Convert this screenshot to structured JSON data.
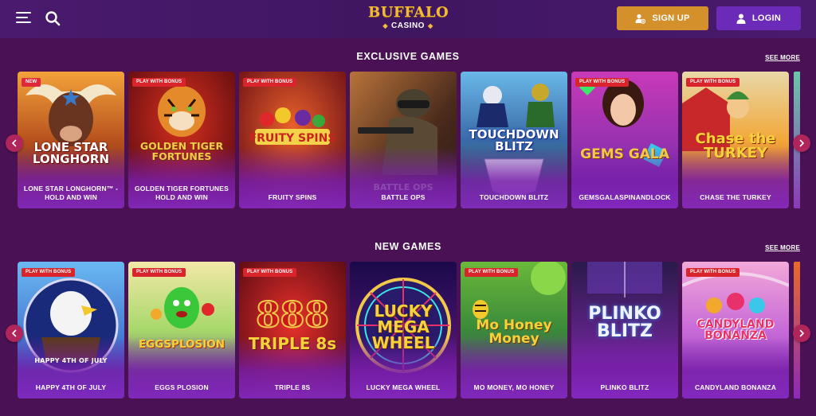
{
  "header": {
    "logo_main": "BUFFALO",
    "logo_sub": "CASINO",
    "signup_label": "SIGN UP",
    "login_label": "LOGIN"
  },
  "sections": [
    {
      "title": "EXCLUSIVE GAMES",
      "see_more": "SEE MORE",
      "games": [
        {
          "name": "LONE STAR LONGHORN™ - HOLD AND WIN",
          "badge": "NEW",
          "art_title": "LONE STAR LONGHORN"
        },
        {
          "name": "GOLDEN TIGER FORTUNES HOLD AND WIN",
          "badge": "PLAY WITH BONUS",
          "art_title": "GOLDEN TIGER FORTUNES"
        },
        {
          "name": "FRUITY SPINS",
          "badge": "PLAY WITH BONUS",
          "art_title": "FRUITY SPINS"
        },
        {
          "name": "BATTLE OPS",
          "badge": "",
          "art_title": "BATTLE OPS"
        },
        {
          "name": "TOUCHDOWN BLITZ",
          "badge": "",
          "art_title": "TOUCHDOWN BLITZ"
        },
        {
          "name": "GEMSGALASPINANDLOCK",
          "badge": "PLAY WITH BONUS",
          "art_title": "GEMS GALA"
        },
        {
          "name": "CHASE THE TURKEY",
          "badge": "PLAY WITH BONUS",
          "art_title": "Chase the TURKEY"
        }
      ]
    },
    {
      "title": "NEW GAMES",
      "see_more": "SEE MORE",
      "games": [
        {
          "name": "HAPPY 4TH OF JULY",
          "badge": "PLAY WITH BONUS",
          "art_title": "HAPPY 4TH OF JULY"
        },
        {
          "name": "EGGS PLOSION",
          "badge": "PLAY WITH BONUS",
          "art_title": "EGGSPLOSION"
        },
        {
          "name": "TRIPLE 8S",
          "badge": "PLAY WITH BONUS",
          "art_title": "TRIPLE 8s"
        },
        {
          "name": "LUCKY MEGA WHEEL",
          "badge": "",
          "art_title": "LUCKY MEGA WHEEL"
        },
        {
          "name": "MO MONEY, MO HONEY",
          "badge": "PLAY WITH BONUS",
          "art_title": "Mo Honey Money"
        },
        {
          "name": "PLINKO BLITZ",
          "badge": "",
          "art_title": "PLINKO BLITZ"
        },
        {
          "name": "CANDYLAND BONANZA",
          "badge": "PLAY WITH BONUS",
          "art_title": "CANDYLAND BONANZA"
        }
      ]
    }
  ],
  "colors": {
    "background": "#4a1254",
    "header": "#3f1660",
    "accent_gold": "#f2b93b",
    "signup": "#d4902a",
    "login": "#6b2bb8",
    "arrow": "#b0255a",
    "badge": "#d8242a"
  },
  "icons": {
    "menu": "hamburger-icon",
    "search": "search-icon",
    "signup": "user-plus-icon",
    "login": "user-icon",
    "prev": "chevron-left-icon",
    "next": "chevron-right-icon"
  }
}
